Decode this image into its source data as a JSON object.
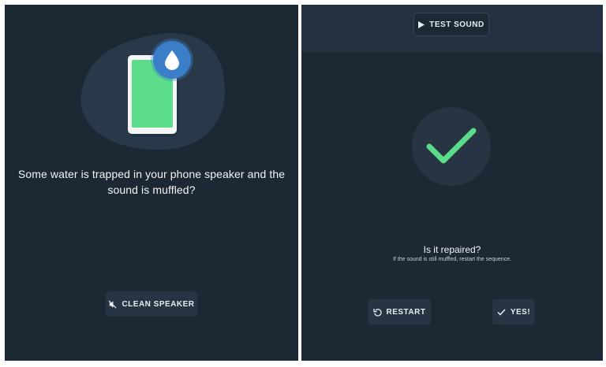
{
  "left_panel": {
    "question": "Some water is trapped in your phone speaker and the sound is muffled?",
    "clean_button": {
      "label": "CLEAN SPEAKER",
      "icon": "speaker-off-icon"
    },
    "illustration": {
      "phone_icon": "phone-icon",
      "badge_icon": "water-drop-icon"
    }
  },
  "right_panel": {
    "test_button": {
      "label": "TEST SOUND",
      "icon": "play-icon"
    },
    "status_icon": "checkmark-icon",
    "title": "Is it repaired?",
    "hint": "If the sound is still muffled, restart the sequence.",
    "restart_button": {
      "label": "RESTART",
      "icon": "restart-icon"
    },
    "yes_button": {
      "label": "YES!",
      "icon": "check-icon"
    }
  },
  "colors": {
    "background": "#1c2834",
    "accent_green": "#5bdc8a",
    "drop_blue": "#3a7ec8",
    "button_bg": "#263444"
  }
}
